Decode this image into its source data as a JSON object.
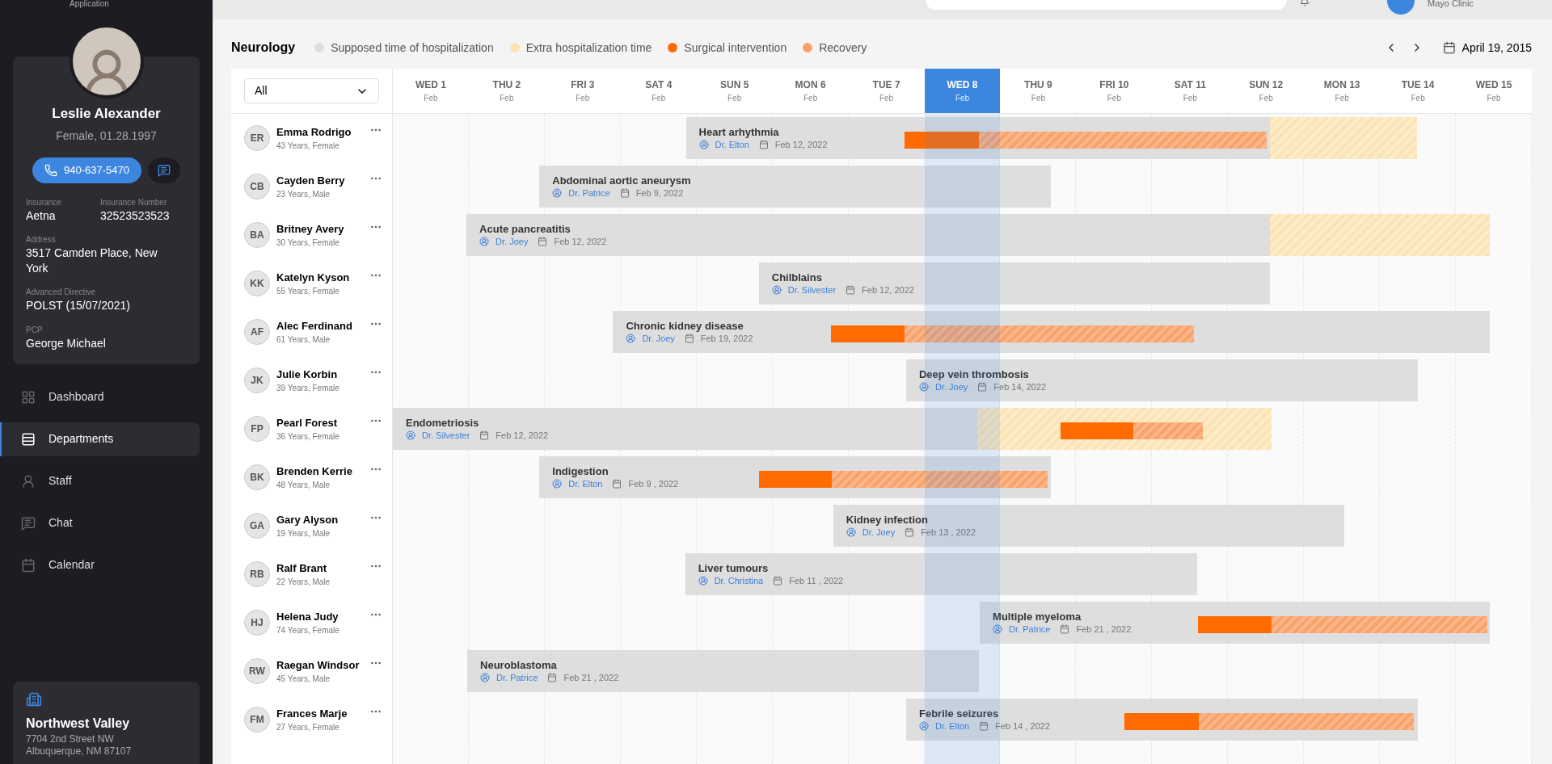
{
  "brand": {
    "subtitle": "Application"
  },
  "header": {
    "clinic": "Mayo Clinic"
  },
  "profile": {
    "name": "Leslie Alexander",
    "details": "Female, 01.28.1997",
    "phone": "940-637-5470",
    "fields": [
      {
        "label": "Insurance",
        "value": "Aetna"
      },
      {
        "label": "Insurance Number",
        "value": "32523523523"
      },
      {
        "label": "Address",
        "value": "3517 Camden Place, New York"
      },
      {
        "label": "Advanced Directive",
        "value": "POLST (15/07/2021)"
      },
      {
        "label": "PCP",
        "value": "George Michael"
      }
    ]
  },
  "nav": [
    {
      "label": "Dashboard",
      "selected": false
    },
    {
      "label": "Departments",
      "selected": true
    },
    {
      "label": "Staff",
      "selected": false
    },
    {
      "label": "Chat",
      "selected": false
    },
    {
      "label": "Calendar",
      "selected": false
    }
  ],
  "location": {
    "name": "Northwest Valley",
    "lines": [
      "7704 2nd Street NW",
      "Albuquerque, NM 87107"
    ]
  },
  "department": "Neurology",
  "legend": [
    {
      "label": "Supposed time of hospitalization",
      "color": "#dedede"
    },
    {
      "label": "Extra hospitalization time",
      "color": "#fbe3b4"
    },
    {
      "label": "Surgical intervention",
      "color": "#ff6b00"
    },
    {
      "label": "Recovery",
      "color": "#f9a26b"
    }
  ],
  "date": "April 19, 2015",
  "filter": {
    "value": "All"
  },
  "days": [
    {
      "day": "WED 1",
      "month": "Feb",
      "selected": false
    },
    {
      "day": "THU 2",
      "month": "Feb",
      "selected": false
    },
    {
      "day": "FRI 3",
      "month": "Feb",
      "selected": false
    },
    {
      "day": "SAT 4",
      "month": "Feb",
      "selected": false
    },
    {
      "day": "SUN 5",
      "month": "Feb",
      "selected": false
    },
    {
      "day": "MON 6",
      "month": "Feb",
      "selected": false
    },
    {
      "day": "TUE 7",
      "month": "Feb",
      "selected": false
    },
    {
      "day": "WED 8",
      "month": "Feb",
      "selected": true
    },
    {
      "day": "THU 9",
      "month": "Feb",
      "selected": false
    },
    {
      "day": "FRI 10",
      "month": "Feb",
      "selected": false
    },
    {
      "day": "SAT 11",
      "month": "Feb",
      "selected": false
    },
    {
      "day": "SUN 12",
      "month": "Feb",
      "selected": false
    },
    {
      "day": "MON 13",
      "month": "Feb",
      "selected": false
    },
    {
      "day": "TUE 14",
      "month": "Feb",
      "selected": false
    },
    {
      "day": "WED 15",
      "month": "Feb",
      "selected": false
    }
  ],
  "patients": [
    {
      "initials": "ER",
      "name": "Emma Rodrigo",
      "info": "43 Years, Female",
      "diagnosis": "Heart arhythmia",
      "doctor": "Dr. Elton",
      "date": "Feb 12, 2022",
      "segments": [
        {
          "kind": "hospitalization"
        },
        {
          "kind": "extra"
        },
        {
          "kind": "surgery"
        },
        {
          "kind": "recovery"
        }
      ]
    },
    {
      "initials": "CB",
      "name": "Cayden Berry",
      "info": "23 Years, Male",
      "diagnosis": "Abdominal aortic aneurysm",
      "doctor": "Dr. Patrice",
      "date": "Feb 9, 2022",
      "segments": [
        {
          "kind": "hospitalization"
        }
      ]
    },
    {
      "initials": "BA",
      "name": "Britney Avery",
      "info": "30 Years, Female",
      "diagnosis": "Acute pancreatitis",
      "doctor": "Dr. Joey",
      "date": "Feb 12, 2022",
      "segments": [
        {
          "kind": "hospitalization"
        },
        {
          "kind": "extra"
        }
      ]
    },
    {
      "initials": "KK",
      "name": "Katelyn Kyson",
      "info": "55 Years, Female",
      "diagnosis": "Chilblains",
      "doctor": "Dr. Silvester",
      "date": "Feb 12, 2022",
      "segments": [
        {
          "kind": "hospitalization"
        }
      ]
    },
    {
      "initials": "AF",
      "name": "Alec Ferdinand",
      "info": "61 Years, Male",
      "diagnosis": "Chronic kidney disease",
      "doctor": "Dr. Joey",
      "date": "Feb 19, 2022",
      "segments": [
        {
          "kind": "hospitalization"
        },
        {
          "kind": "surgery"
        },
        {
          "kind": "recovery"
        }
      ]
    },
    {
      "initials": "JK",
      "name": "Julie Korbin",
      "info": "39 Years, Female",
      "diagnosis": "Deep vein thrombosis",
      "doctor": "Dr. Joey",
      "date": "Feb 14, 2022",
      "segments": [
        {
          "kind": "hospitalization"
        }
      ]
    },
    {
      "initials": "FP",
      "name": "Pearl Forest",
      "info": "36 Years, Female",
      "diagnosis": "Endometriosis",
      "doctor": "Dr. Silvester",
      "date": "Feb 12, 2022",
      "segments": [
        {
          "kind": "hospitalization"
        },
        {
          "kind": "extra"
        },
        {
          "kind": "surgery"
        },
        {
          "kind": "recovery"
        }
      ]
    },
    {
      "initials": "BK",
      "name": "Brenden Kerrie",
      "info": "48 Years, Male",
      "diagnosis": "Indigestion",
      "doctor": "Dr. Elton",
      "date": "Feb 9 , 2022",
      "segments": [
        {
          "kind": "hospitalization"
        },
        {
          "kind": "surgery"
        },
        {
          "kind": "recovery"
        }
      ]
    },
    {
      "initials": "GA",
      "name": "Gary Alyson",
      "info": "19 Years, Male",
      "diagnosis": "Kidney infection",
      "doctor": "Dr. Joey",
      "date": "Feb 13 , 2022",
      "segments": [
        {
          "kind": "hospitalization"
        }
      ]
    },
    {
      "initials": "RB",
      "name": "Ralf Brant",
      "info": "22 Years, Male",
      "diagnosis": "Liver tumours",
      "doctor": "Dr. Christina",
      "date": "Feb 11 , 2022",
      "segments": [
        {
          "kind": "hospitalization"
        }
      ]
    },
    {
      "initials": "HJ",
      "name": "Helena Judy",
      "info": "74 Years, Female",
      "diagnosis": "Multiple myeloma",
      "doctor": "Dr. Patrice",
      "date": "Feb 21 , 2022",
      "segments": [
        {
          "kind": "hospitalization"
        },
        {
          "kind": "surgery"
        },
        {
          "kind": "recovery"
        }
      ]
    },
    {
      "initials": "RW",
      "name": "Raegan Windsor",
      "info": "45 Years, Male",
      "diagnosis": "Neuroblastoma",
      "doctor": "Dr. Patrice",
      "date": "Feb 21 , 2022",
      "segments": [
        {
          "kind": "hospitalization"
        }
      ]
    },
    {
      "initials": "FM",
      "name": "Frances Marje",
      "info": "27 Years, Female",
      "diagnosis": "Febrile seizures",
      "doctor": "Dr. Elton",
      "date": "Feb 14 , 2022",
      "segments": [
        {
          "kind": "hospitalization"
        },
        {
          "kind": "surgery"
        },
        {
          "kind": "recovery"
        }
      ]
    }
  ]
}
